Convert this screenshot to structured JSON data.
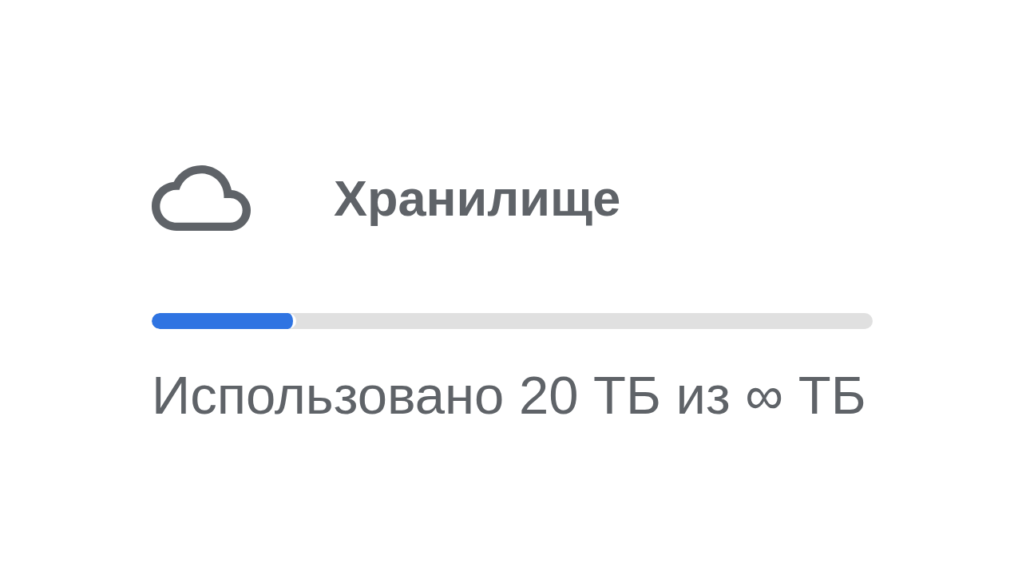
{
  "storage": {
    "title": "Хранилище",
    "usage": {
      "level": 0.2,
      "caption": "Использовано 20 ТБ из ∞ ТБ"
    }
  }
}
